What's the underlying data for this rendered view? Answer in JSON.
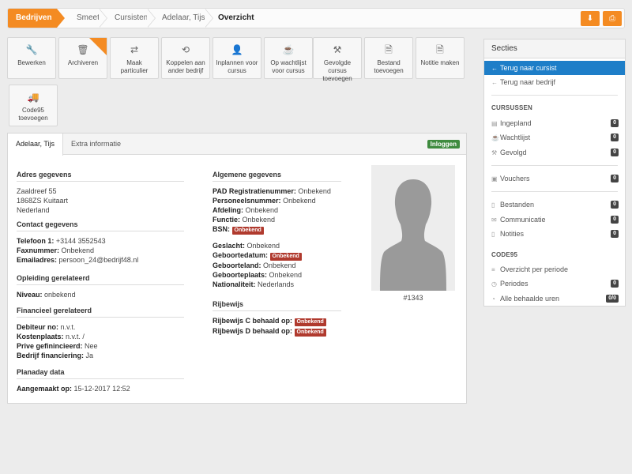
{
  "breadcrumb": [
    "Bedrijven",
    "Smeets",
    "Cursisten",
    "Adelaar, Tijs",
    "Overzicht"
  ],
  "top_actions": [
    {
      "icon": "download-icon",
      "glyph": "⬇"
    },
    {
      "icon": "print-icon",
      "glyph": "⎙"
    }
  ],
  "tiles": [
    {
      "label": "Bewerken",
      "icon": "wrench-icon",
      "glyph": "🔧"
    },
    {
      "label": "Archiveren",
      "icon": "trash-icon",
      "glyph": "🗑"
    },
    {
      "label": "Maak particulier",
      "icon": "shuffle-icon",
      "glyph": "⇄"
    },
    {
      "label": "Koppelen aan ander bedrijf",
      "icon": "retweet-icon",
      "glyph": "⟲"
    },
    {
      "label": "Inplannen voor cursus",
      "icon": "user-icon",
      "glyph": "👤"
    },
    {
      "label": "Op wachtlijst voor cursus",
      "icon": "coffee-icon",
      "glyph": "☕"
    },
    {
      "label": "Gevolgde cursus toevoegen",
      "icon": "gavel-icon",
      "glyph": "⚒"
    },
    {
      "label": "Bestand toevoegen",
      "icon": "file-icon",
      "glyph": "🗎"
    },
    {
      "label": "Notitie maken",
      "icon": "file-icon",
      "glyph": "🗎"
    },
    {
      "label": "Code95 toevoegen",
      "icon": "truck-icon",
      "glyph": "🚚"
    }
  ],
  "tabs": {
    "active": "Adelaar, Tijs",
    "other": "Extra informatie",
    "badge": "Inloggen"
  },
  "address": {
    "title": "Adres gegevens",
    "street": "Zaaldreef 55",
    "city": "1868ZS Kuitaart",
    "country": "Nederland"
  },
  "contact": {
    "title": "Contact gegevens",
    "phone_label": "Telefoon 1:",
    "phone": "+3144 3552543",
    "fax_label": "Faxnummer:",
    "fax": "Onbekend",
    "email_label": "Emailadres:",
    "email": "persoon_24@bedrijf48.nl"
  },
  "education": {
    "title": "Opleiding gerelateerd",
    "level_label": "Niveau:",
    "level": "onbekend"
  },
  "financial": {
    "title": "Financieel gerelateerd",
    "debtor_label": "Debiteur no:",
    "debtor": "n.v.t.",
    "cost_label": "Kostenplaats:",
    "cost": "n.v.t. /",
    "private_label": "Prive gefinincieerd:",
    "private": "Nee",
    "company_label": "Bedrijf financiering:",
    "company": "Ja"
  },
  "planaday": {
    "title": "Planaday data",
    "created_label": "Aangemaakt op:",
    "created": "15-12-2017 12:52"
  },
  "general": {
    "title": "Algemene gegevens",
    "pad_label": "PAD Registratienummer:",
    "pad": "Onbekend",
    "staff_label": "Personeelsnummer:",
    "staff": "Onbekend",
    "dept_label": "Afdeling:",
    "dept": "Onbekend",
    "func_label": "Functie:",
    "func": "Onbekend",
    "bsn_label": "BSN:",
    "bsn": "Onbekend",
    "gender_label": "Geslacht:",
    "gender": "Onbekend",
    "dob_label": "Geboortedatum:",
    "dob": "Onbekend",
    "country_label": "Geboorteland:",
    "country": "Onbekend",
    "place_label": "Geboorteplaats:",
    "place": "Onbekend",
    "nation_label": "Nationaliteit:",
    "nation": "Nederlands"
  },
  "license": {
    "title": "Rijbewijs",
    "c_label": "Rijbewijs C behaald op:",
    "c": "Onbekend",
    "d_label": "Rijbewijs D behaald op:",
    "d": "Onbekend"
  },
  "photo_id": "#1343",
  "sidebar": {
    "title": "Secties",
    "back_student": "Terug naar cursist",
    "back_company": "Terug naar bedrijf",
    "courses_head": "CURSUSSEN",
    "planned": "Ingepland",
    "planned_count": "0",
    "waitlist": "Wachtlijst",
    "waitlist_count": "0",
    "followed": "Gevolgd",
    "followed_count": "0",
    "vouchers": "Vouchers",
    "vouchers_count": "0",
    "files": "Bestanden",
    "files_count": "0",
    "comms": "Communicatie",
    "comms_count": "0",
    "notes": "Notities",
    "notes_count": "0",
    "code95_head": "CODE95",
    "overview": "Overzicht per periode",
    "periods": "Periodes",
    "periods_count": "0",
    "hours": "Alle behaalde uren",
    "hours_count": "0/0"
  },
  "colors": {
    "accent": "#f48b22",
    "active": "#1e7ec8",
    "badge_red": "#b03a2e",
    "badge_green": "#3f8b3f"
  }
}
